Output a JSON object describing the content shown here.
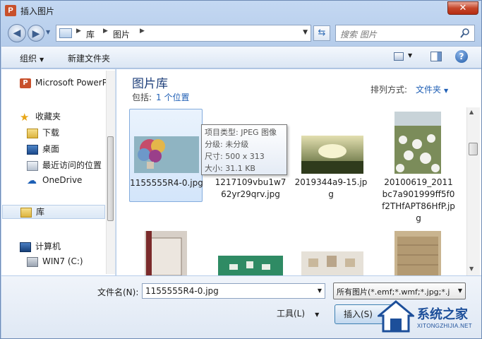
{
  "window": {
    "title": "插入图片",
    "app_icon_letter": "P",
    "close_glyph": "✕"
  },
  "address": {
    "crumbs": [
      "库",
      "图片"
    ]
  },
  "search": {
    "placeholder": "搜索 图片"
  },
  "toolbar": {
    "organize": "组织",
    "new_folder": "新建文件夹"
  },
  "nav": {
    "items": [
      {
        "label": "Microsoft PowerP",
        "icon": "powerpoint-icon"
      },
      {
        "label": "收藏夹",
        "icon": "star-icon"
      },
      {
        "label": "下载",
        "icon": "download-folder-icon"
      },
      {
        "label": "桌面",
        "icon": "desktop-icon"
      },
      {
        "label": "最近访问的位置",
        "icon": "recent-places-icon"
      },
      {
        "label": "OneDrive",
        "icon": "onedrive-icon"
      },
      {
        "label": "库",
        "icon": "library-icon"
      },
      {
        "label": "计算机",
        "icon": "computer-icon"
      },
      {
        "label": "WIN7 (C:)",
        "icon": "drive-icon"
      }
    ]
  },
  "library": {
    "title": "图片库",
    "includes_label": "包括:",
    "includes_link": "1 个位置",
    "sort_label": "排列方式:",
    "sort_value": "文件夹"
  },
  "files": [
    {
      "name": "1155555R4-0.jpg",
      "selected": true
    },
    {
      "name": "1217109vbu1w762yr29qrv.jpg",
      "selected": false
    },
    {
      "name": "2019344a9-15.jpg",
      "selected": false
    },
    {
      "name": "20100619_2011bc7a901999ff5f0f2THfAPT86HfP.jpg",
      "selected": false
    },
    {
      "name": "",
      "selected": false
    },
    {
      "name": "",
      "selected": false
    },
    {
      "name": "",
      "selected": false
    },
    {
      "name": "",
      "selected": false
    }
  ],
  "tooltip": {
    "type": "项目类型: JPEG 图像",
    "rating": "分级: 未分级",
    "dimensions": "尺寸: 500 x 313",
    "size": "大小: 31.1 KB"
  },
  "bottom": {
    "filename_label": "文件名(N):",
    "filename_value": "1155555R4-0.jpg",
    "filter_value": "所有图片(*.emf;*.wmf;*.jpg;*.j",
    "tools": "工具(L)",
    "insert": "插入(S)"
  },
  "watermark": {
    "text": "系统之家",
    "url": "XITONGZHIJIA.NET"
  },
  "colors": {
    "accent": "#1f5fb5",
    "title_blue": "#1e3f7a",
    "selection": "#d3e5fa"
  }
}
